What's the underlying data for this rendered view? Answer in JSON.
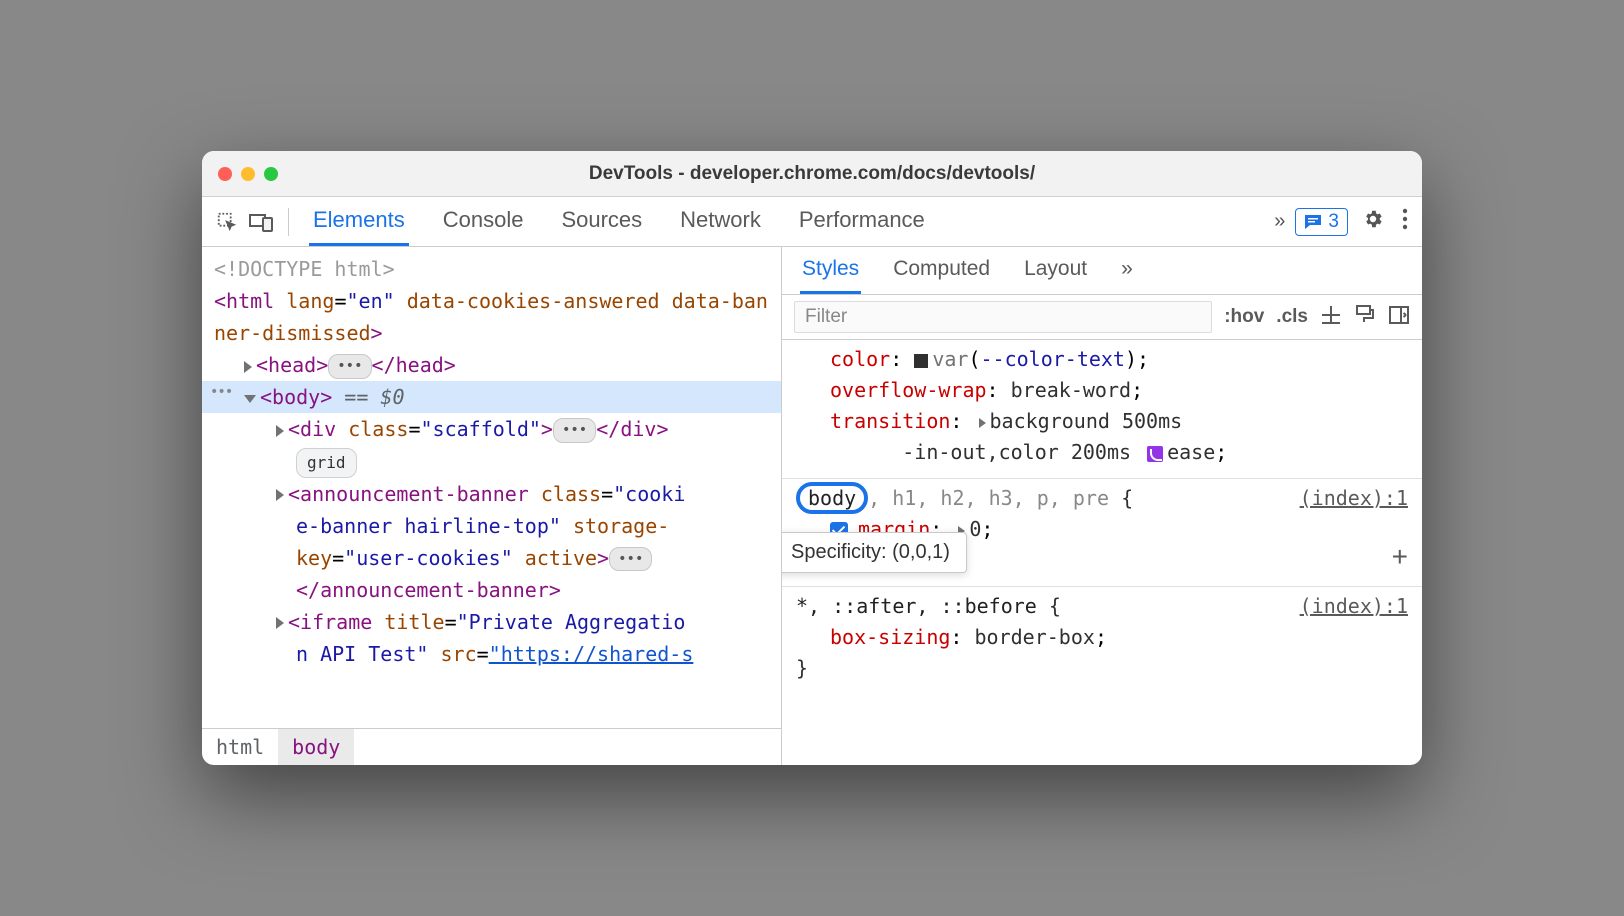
{
  "window": {
    "title": "DevTools - developer.chrome.com/docs/devtools/"
  },
  "toolbar": {
    "tabs": [
      "Elements",
      "Console",
      "Sources",
      "Network",
      "Performance"
    ],
    "active_tab": 0,
    "issues_count": "3"
  },
  "dom": {
    "doctype": "<!DOCTYPE html>",
    "html_open": "<html lang=\"en\" data-cookies-answered data-banner-dismissed>",
    "head": {
      "open": "<head>",
      "close": "</head>"
    },
    "body_open": "<body>",
    "body_marker": "== $0",
    "scaffold": {
      "open": "<div class=\"scaffold\">",
      "close": "</div>",
      "badge": "grid"
    },
    "banner_line1": "<announcement-banner class=\"cooki",
    "banner_line2": "e-banner hairline-top\" storage-",
    "banner_line3a": "key=",
    "banner_line3b": "\"user-cookies\"",
    "banner_line3c": " active>",
    "banner_close": "</announcement-banner>",
    "iframe_line1a": "<iframe title=",
    "iframe_line1b": "\"Private Aggregatio",
    "iframe_line2a": "n API Test\"",
    "iframe_line2b": " src=",
    "iframe_link": "\"https://shared-s"
  },
  "breadcrumb": [
    "html",
    "body"
  ],
  "styles_panel": {
    "subtabs": [
      "Styles",
      "Computed",
      "Layout"
    ],
    "active_subtab": 0,
    "filter_placeholder": "Filter",
    "hov": ":hov",
    "cls": ".cls"
  },
  "tooltip": "Specificity: (0,0,1)",
  "rules": {
    "r1": {
      "p1_name": "color",
      "p1_var": "var",
      "p1_varname": "--color-text",
      "p2_name": "overflow-wrap",
      "p2_val": "break-word",
      "p3_name": "transition",
      "p3_val_a": "background 500ms",
      "p3_val_b": "-in-out,color 200ms",
      "p3_val_c": "ease"
    },
    "r2": {
      "sel_hl": "body",
      "sel_rest": "h1, h2, h3, p, pre",
      "src": "(index):1",
      "p1_name": "margin",
      "p1_val": "0"
    },
    "r3": {
      "sel": "*, ::after, ::before",
      "src": "(index):1",
      "p1_name": "box-sizing",
      "p1_val": "border-box"
    }
  }
}
